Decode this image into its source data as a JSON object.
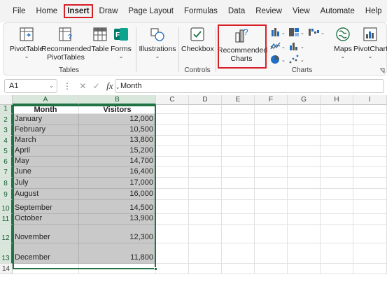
{
  "menu": {
    "items": [
      "File",
      "Home",
      "Insert",
      "Draw",
      "Page Layout",
      "Formulas",
      "Data",
      "Review",
      "View",
      "Automate",
      "Help"
    ],
    "active": "Insert"
  },
  "ribbon": {
    "tables_group": {
      "label": "Tables",
      "pivottable": "PivotTable",
      "recommended_pivottables_line1": "Recommended",
      "recommended_pivottables_line2": "PivotTables",
      "table": "Table",
      "forms": "Forms"
    },
    "illustrations": "Illustrations",
    "controls_group": {
      "label": "Controls",
      "checkbox": "Checkbox"
    },
    "charts_group": {
      "label": "Charts",
      "recommended_charts_line1": "Recommended",
      "recommended_charts_line2": "Charts",
      "maps": "Maps",
      "pivotchart": "PivotChart"
    },
    "caret": "⌄"
  },
  "formula_bar": {
    "name_box": "A1",
    "fx": "fx",
    "content": "Month"
  },
  "grid": {
    "columns": [
      "A",
      "B",
      "C",
      "D",
      "E",
      "F",
      "G",
      "H",
      "I"
    ],
    "rows": [
      "1",
      "2",
      "3",
      "4",
      "5",
      "6",
      "7",
      "8",
      "9",
      "10",
      "11",
      "12",
      "13",
      "14"
    ],
    "header": {
      "month": "Month",
      "visitors": "Visitors"
    },
    "data": [
      {
        "month": "January",
        "visitors": "12,000"
      },
      {
        "month": "February",
        "visitors": "10,500"
      },
      {
        "month": "March",
        "visitors": "13,800"
      },
      {
        "month": "April",
        "visitors": "15,200"
      },
      {
        "month": "May",
        "visitors": "14,700"
      },
      {
        "month": "June",
        "visitors": "16,400"
      },
      {
        "month": "July",
        "visitors": "17,000"
      },
      {
        "month": "August",
        "visitors": "16,000"
      },
      {
        "month": "September",
        "visitors": "14,500"
      },
      {
        "month": "October",
        "visitors": "13,900"
      },
      {
        "month": "November",
        "visitors": "12,300"
      },
      {
        "month": "December",
        "visitors": "11,800"
      }
    ]
  },
  "colors": {
    "accent_green": "#217346",
    "highlight_red": "#d61f26",
    "selection_fill": "#c9c9c9"
  }
}
